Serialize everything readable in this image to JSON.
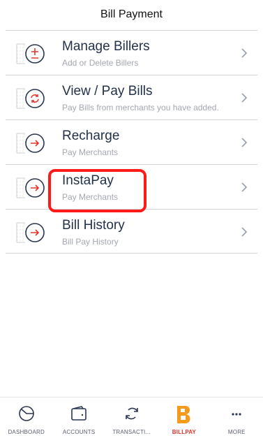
{
  "header": {
    "title": "Bill Payment"
  },
  "menu": [
    {
      "title": "Manage Billers",
      "subtitle": "Add or Delete Billers",
      "icon": "plus-minus-icon"
    },
    {
      "title": "View / Pay Bills",
      "subtitle": "Pay Bills from merchants you have added.",
      "icon": "refresh-icon"
    },
    {
      "title": "Recharge",
      "subtitle": "Pay Merchants",
      "icon": "arrow-right-icon"
    },
    {
      "title": "InstaPay",
      "subtitle": "Pay Merchants",
      "icon": "arrow-right-icon"
    },
    {
      "title": "Bill History",
      "subtitle": "Bill Pay History",
      "icon": "arrow-right-icon"
    }
  ],
  "tabs": [
    {
      "label": "DASHBOARD",
      "icon": "dashboard-icon"
    },
    {
      "label": "ACCOUNTS",
      "icon": "wallet-icon"
    },
    {
      "label": "TRANSACTI...",
      "icon": "transfer-icon"
    },
    {
      "label": "BILLPAY",
      "icon": "billpay-logo-icon",
      "active": true
    },
    {
      "label": "MORE",
      "icon": "more-icon"
    }
  ],
  "colors": {
    "accent": "#e5342a",
    "highlight": "#ff1a1a",
    "billpay_orange": "#f59a1b"
  }
}
